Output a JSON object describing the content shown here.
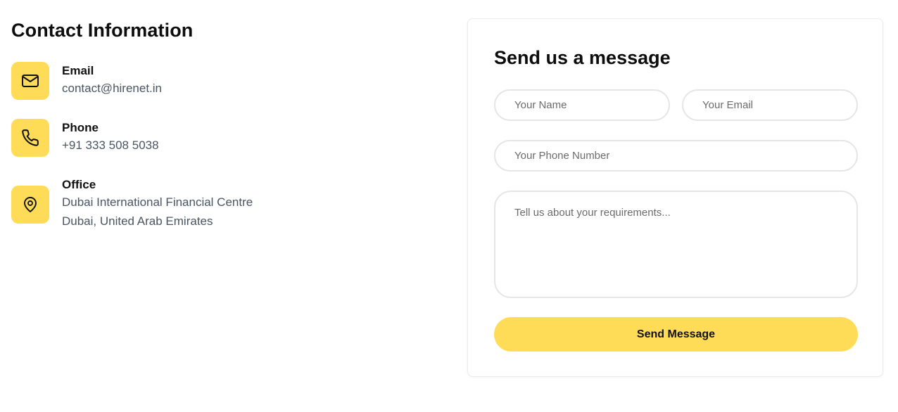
{
  "contact": {
    "title": "Contact Information",
    "items": [
      {
        "icon": "mail-icon",
        "label": "Email",
        "lines": [
          "contact@hirenet.in"
        ]
      },
      {
        "icon": "phone-icon",
        "label": "Phone",
        "lines": [
          "+91 333 508 5038"
        ]
      },
      {
        "icon": "map-pin-icon",
        "label": "Office",
        "lines": [
          "Dubai International Financial Centre",
          "Dubai, United Arab Emirates"
        ]
      }
    ]
  },
  "form": {
    "title": "Send us a message",
    "name_placeholder": "Your Name",
    "name_value": "",
    "email_placeholder": "Your Email",
    "email_value": "",
    "phone_placeholder": "Your Phone Number",
    "phone_value": "",
    "message_placeholder": "Tell us about your requirements...",
    "message_value": "",
    "submit_label": "Send Message"
  },
  "colors": {
    "accent": "#ffdc57",
    "text_dark": "#111111",
    "text_muted": "#4a5563",
    "border": "#e6e6e6"
  }
}
